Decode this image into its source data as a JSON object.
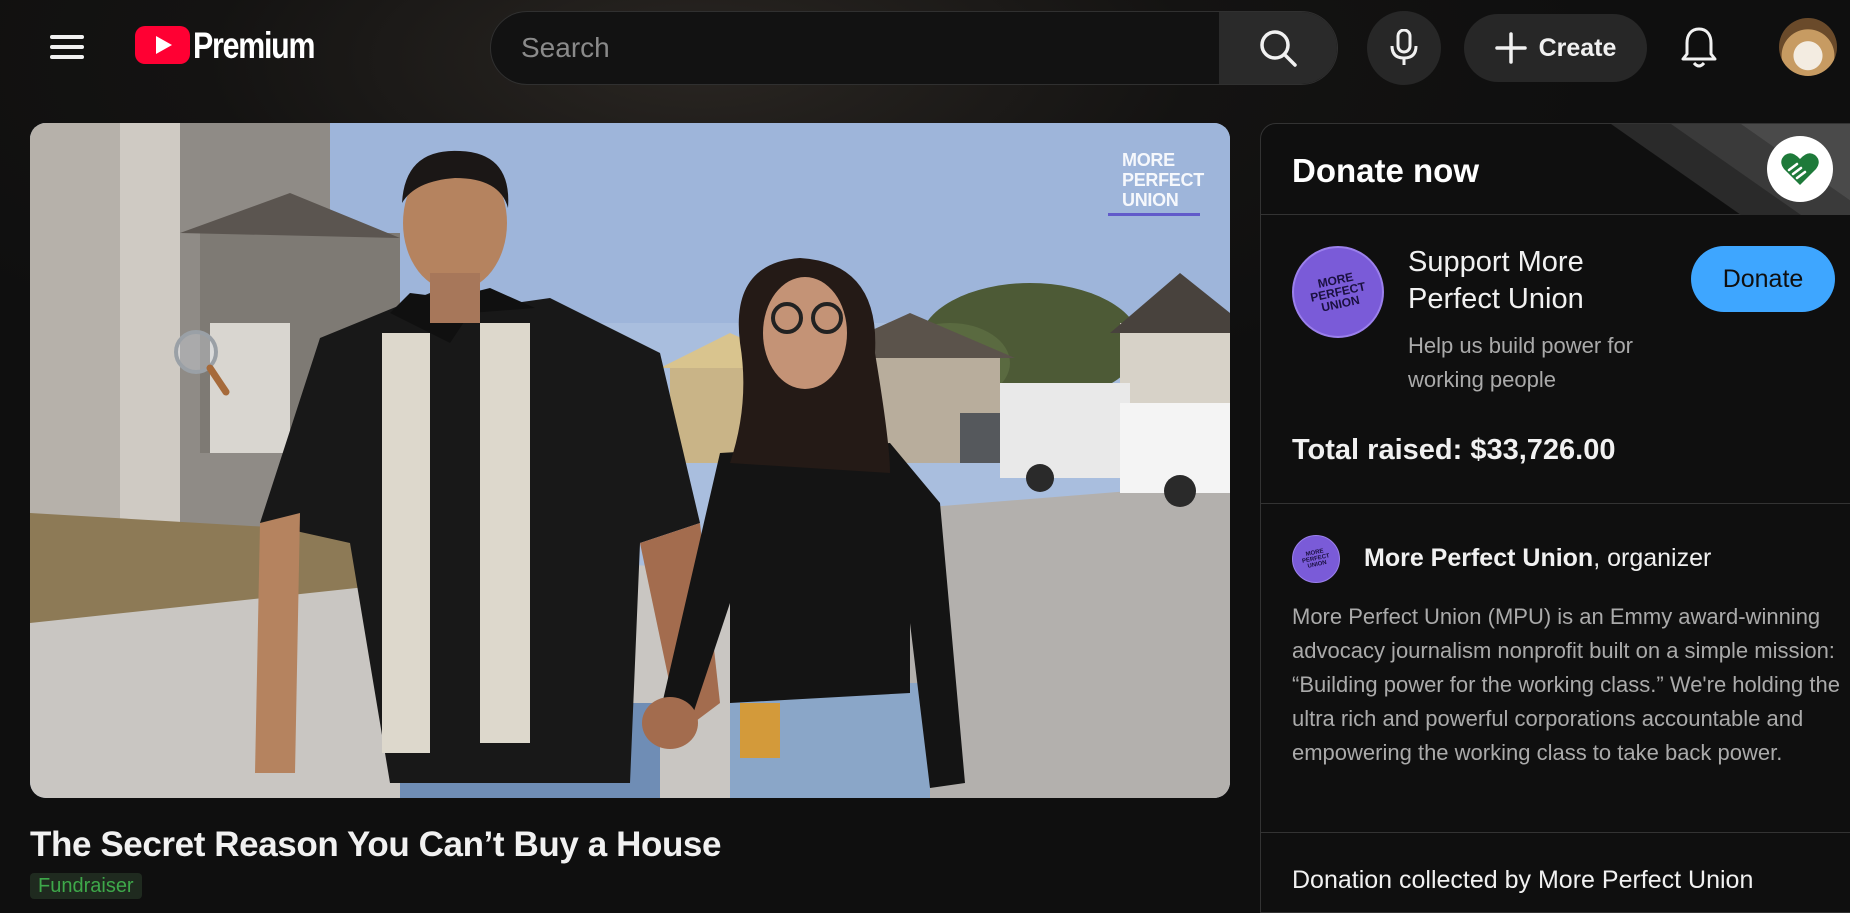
{
  "header": {
    "logo_text": "Premium",
    "search_placeholder": "Search",
    "create_label": "Create"
  },
  "icons": {
    "menu": "hamburger-menu-icon",
    "logo": "youtube-play-icon",
    "search": "search-icon",
    "mic": "microphone-icon",
    "create": "plus-icon",
    "notifications": "bell-icon",
    "magnifier": "magnifier-cursor-icon",
    "donate_badge": "heart-hands-icon"
  },
  "colors": {
    "accent_red": "#ff0033",
    "donate_blue": "#3ea6ff",
    "fundraiser_green": "#3ea84a",
    "org_purple": "#7a5bd8"
  },
  "video": {
    "watermark_lines": [
      "MORE",
      "PERFECT",
      "UNION"
    ],
    "title": "The Secret Reason You Can’t Buy a House",
    "badge": "Fundraiser"
  },
  "donate_panel": {
    "header_title": "Donate now",
    "org_logo_lines": [
      "MORE",
      "PERFECT",
      "UNION"
    ],
    "support_title": "Support More Perfect Union",
    "support_subtitle": "Help us build power for working people",
    "donate_button": "Donate",
    "total_raised": "Total raised: $33,726.00",
    "organizer_name": "More Perfect Union",
    "organizer_role": ", organizer",
    "description": "More Perfect Union (MPU) is an Emmy award-winning advocacy journalism nonprofit built on a simple mission: “Building power for the working class.” We're holding the ultra rich and powerful corporations accountable and empowering the working class to take back power.",
    "collected_by": "Donation collected by More Perfect Union"
  }
}
